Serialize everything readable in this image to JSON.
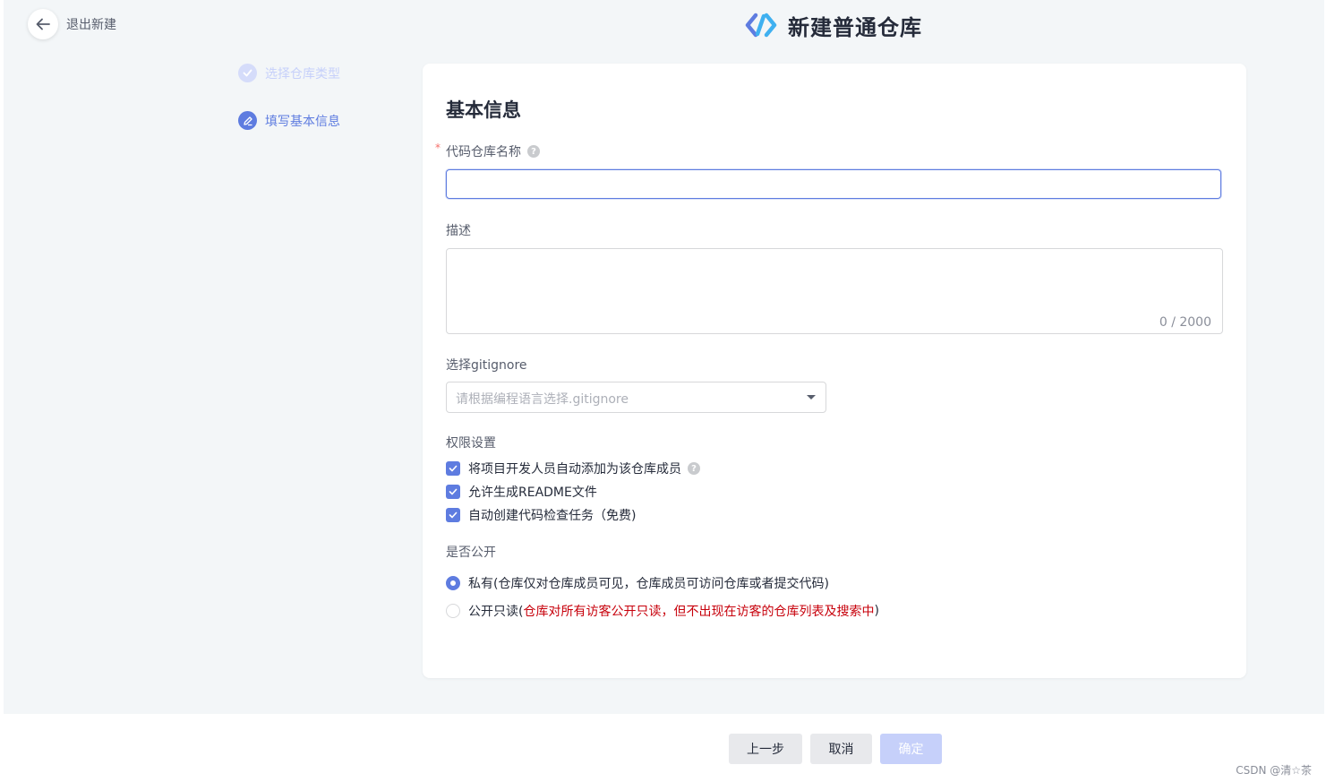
{
  "header": {
    "back_label": "退出新建",
    "title": "新建普通仓库"
  },
  "steps": [
    {
      "label": "选择仓库类型",
      "state": "done"
    },
    {
      "label": "填写基本信息",
      "state": "active"
    }
  ],
  "form": {
    "section_title": "基本信息",
    "repo_name": {
      "label": "代码仓库名称",
      "required": true,
      "value": ""
    },
    "description": {
      "label": "描述",
      "value": "",
      "counter": "0 / 2000"
    },
    "gitignore": {
      "label": "选择gitignore",
      "placeholder": "请根据编程语言选择.gitignore"
    },
    "permissions": {
      "label": "权限设置",
      "options": [
        {
          "label": "将项目开发人员自动添加为该仓库成员",
          "checked": true,
          "has_help": true
        },
        {
          "label": "允许生成README文件",
          "checked": true
        },
        {
          "label": "自动创建代码检查任务（免费)",
          "checked": true
        }
      ]
    },
    "visibility": {
      "label": "是否公开",
      "options": [
        {
          "label": "私有(仓库仅对仓库成员可见，仓库成员可访问仓库或者提交代码)",
          "selected": true
        },
        {
          "label_prefix": "公开只读(",
          "label_warning": "仓库对所有访客公开只读，但不出现在访客的仓库列表及搜索中",
          "label_suffix": " )",
          "selected": false
        }
      ]
    }
  },
  "footer": {
    "prev_label": "上一步",
    "cancel_label": "取消",
    "ok_label": "确定"
  },
  "watermark": "CSDN @清☆茶",
  "colors": {
    "accent": "#5e7ce0",
    "accent_disabled": "#c6d0fa",
    "warning_text": "#c7000b",
    "background": "#f3f6f8"
  }
}
